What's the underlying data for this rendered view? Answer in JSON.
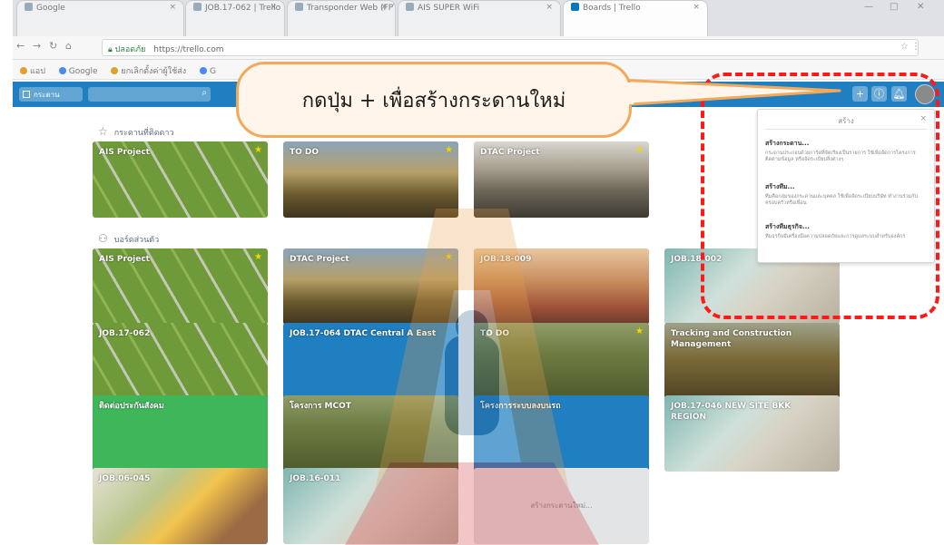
{
  "browser": {
    "tabs": [
      {
        "label": "Google"
      },
      {
        "label": "JOB.17-062 | Trello"
      },
      {
        "label": "Transponder Web (FPT)"
      },
      {
        "label": "AIS SUPER WiFi"
      },
      {
        "label": "Boards | Trello"
      }
    ],
    "url_secure": "ปลอดภัย",
    "url": "https://trello.com",
    "bookmarks": [
      "แอป",
      "Google",
      "ยกเลิกตั้งค่าผู้ใช้ส่ง",
      "G"
    ]
  },
  "trello": {
    "boards_label": "กระดาน",
    "header_buttons": [
      "+",
      "i",
      "bell"
    ]
  },
  "sections": {
    "starred_title": "กระดานที่ติดดาว",
    "personal_title": "บอร์ดส่วนตัว"
  },
  "starred_boards": [
    {
      "name": "AIS Project"
    },
    {
      "name": "TO DO"
    },
    {
      "name": "DTAC Project"
    }
  ],
  "personal_boards": [
    {
      "name": "AIS Project"
    },
    {
      "name": "DTAC Project"
    },
    {
      "name": "JOB.18-009"
    },
    {
      "name": "JOB.18-002"
    },
    {
      "name": "JOB.17-062"
    },
    {
      "name": "JOB.17-064 DTAC Central A East"
    },
    {
      "name": "TO DO"
    },
    {
      "name": "Tracking and Construction Management"
    },
    {
      "name": "ติดต่อประกันสังคม"
    },
    {
      "name": "โครงการ MCOT"
    },
    {
      "name": "โครงการระบบลงบนรถ"
    },
    {
      "name": "JOB.17-046 NEW SITE BKK REGION"
    },
    {
      "name": "JOB.06-045"
    },
    {
      "name": "JOB.16-011"
    }
  ],
  "create_tile": "สร้างกระดานใหม่...",
  "create_menu": {
    "title": "สร้าง",
    "items": [
      {
        "title": "สร้างกระดาน...",
        "desc": "กระดานประกอบด้วยการ์ดที่จัดเรียงเป็นรายการ ใช้เพื่อจัดการโครงการ ติดตามข้อมูล หรือจัดระเบียบสิ่งต่างๆ"
      },
      {
        "title": "สร้างทีม...",
        "desc": "ทีมคือกลุ่มของกระดานและบุคคล ใช้เพื่อจัดระเบียบบริษัท ทำงานร่วมกับครอบครัวหรือเพื่อน"
      },
      {
        "title": "สร้างทีมธุรกิจ...",
        "desc": "ทีมธุรกิจมีเครื่องมือความปลอดภัยและการดูแลระบบสำหรับองค์กร"
      }
    ]
  },
  "annotation": {
    "callout_text": "กดปุ่ม + เพื่อสร้างกระดานใหม่",
    "highlight_color": "#ff1a1a",
    "callout_border_color": "#f3a85a"
  }
}
